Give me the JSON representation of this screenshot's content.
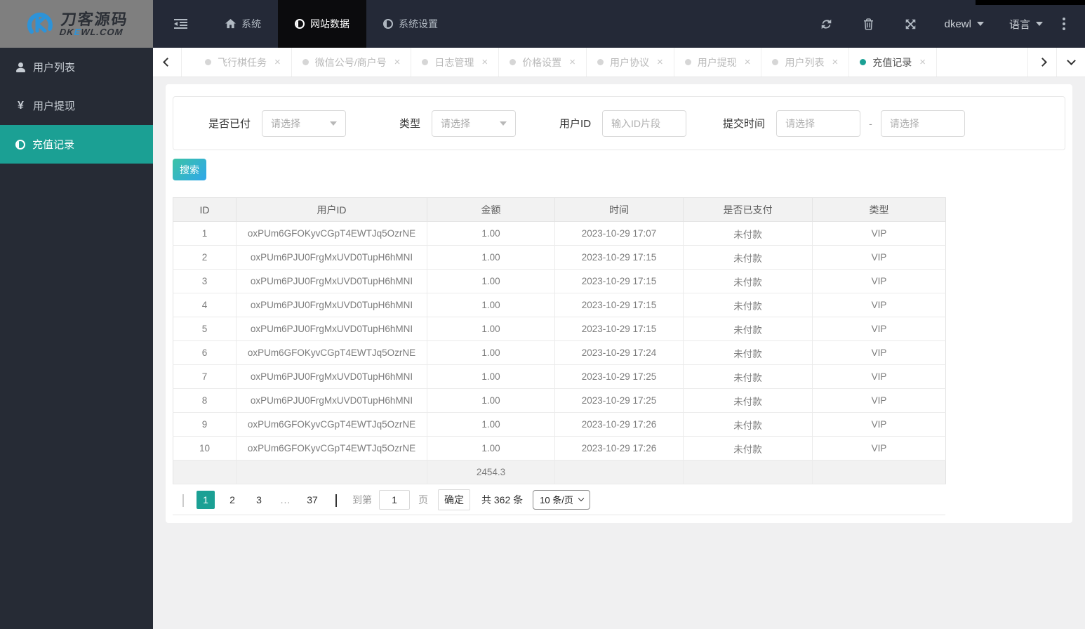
{
  "navbar": {
    "logo": {
      "title": "刀客源码",
      "sub1": "DK",
      "sub2": "E",
      "sub3": "WL.COM"
    },
    "menu": [
      {
        "label": "系统",
        "icon": "home"
      },
      {
        "label": "网站数据",
        "icon": "adjust",
        "active": true
      },
      {
        "label": "系统设置",
        "icon": "adjust"
      }
    ],
    "username": "dkewl",
    "language_label": "语言"
  },
  "tabs": [
    {
      "label": "飞行棋任务",
      "close": "×"
    },
    {
      "label": "微信公号/商户号",
      "close": "×"
    },
    {
      "label": "日志管理",
      "close": "×"
    },
    {
      "label": "价格设置",
      "close": "×"
    },
    {
      "label": "用户协议",
      "close": "×"
    },
    {
      "label": "用户提现",
      "close": "×"
    },
    {
      "label": "用户列表",
      "close": "×"
    },
    {
      "label": "充值记录",
      "close": "×",
      "active": true
    }
  ],
  "sidebar": [
    {
      "label": "用户列表",
      "icon": "user"
    },
    {
      "label": "用户提现",
      "icon": "yen"
    },
    {
      "label": "充值记录",
      "icon": "adjust",
      "active": true
    }
  ],
  "filters": {
    "paid": {
      "label": "是否已付",
      "placeholder": "请选择"
    },
    "type": {
      "label": "类型",
      "placeholder": "请选择"
    },
    "user_id": {
      "label": "用户ID",
      "placeholder": "输入ID片段"
    },
    "time": {
      "label": "提交时间",
      "from_placeholder": "请选择",
      "to_placeholder": "请选择",
      "separator": "-"
    }
  },
  "search_label": "搜索",
  "table": {
    "columns": [
      "ID",
      "用户ID",
      "金额",
      "时间",
      "是否已支付",
      "类型"
    ],
    "rows": [
      [
        "1",
        "oxPUm6GFOKyvCGpT4EWTJq5OzrNE",
        "1.00",
        "2023-10-29 17:07",
        "未付款",
        "VIP"
      ],
      [
        "2",
        "oxPUm6PJU0FrgMxUVD0TupH6hMNI",
        "1.00",
        "2023-10-29 17:15",
        "未付款",
        "VIP"
      ],
      [
        "3",
        "oxPUm6PJU0FrgMxUVD0TupH6hMNI",
        "1.00",
        "2023-10-29 17:15",
        "未付款",
        "VIP"
      ],
      [
        "4",
        "oxPUm6PJU0FrgMxUVD0TupH6hMNI",
        "1.00",
        "2023-10-29 17:15",
        "未付款",
        "VIP"
      ],
      [
        "5",
        "oxPUm6PJU0FrgMxUVD0TupH6hMNI",
        "1.00",
        "2023-10-29 17:15",
        "未付款",
        "VIP"
      ],
      [
        "6",
        "oxPUm6GFOKyvCGpT4EWTJq5OzrNE",
        "1.00",
        "2023-10-29 17:24",
        "未付款",
        "VIP"
      ],
      [
        "7",
        "oxPUm6PJU0FrgMxUVD0TupH6hMNI",
        "1.00",
        "2023-10-29 17:25",
        "未付款",
        "VIP"
      ],
      [
        "8",
        "oxPUm6PJU0FrgMxUVD0TupH6hMNI",
        "1.00",
        "2023-10-29 17:25",
        "未付款",
        "VIP"
      ],
      [
        "9",
        "oxPUm6GFOKyvCGpT4EWTJq5OzrNE",
        "1.00",
        "2023-10-29 17:26",
        "未付款",
        "VIP"
      ],
      [
        "10",
        "oxPUm6GFOKyvCGpT4EWTJq5OzrNE",
        "1.00",
        "2023-10-29 17:26",
        "未付款",
        "VIP"
      ]
    ],
    "summary_amount": "2454.3"
  },
  "pagination": {
    "pages": [
      {
        "label": "1",
        "active": true
      },
      {
        "label": "2"
      },
      {
        "label": "3"
      },
      {
        "label": "...",
        "ellipsis": true
      },
      {
        "label": "37"
      }
    ],
    "goto_label": "到第",
    "goto_value": "1",
    "page_word": "页",
    "confirm_label": "确定",
    "total_label": "共 362 条",
    "page_size_label": "10 条/页"
  },
  "colors": {
    "accent_teal": "#1ba094",
    "navbar": "#242937",
    "active_nav": "#0b0b0d"
  }
}
